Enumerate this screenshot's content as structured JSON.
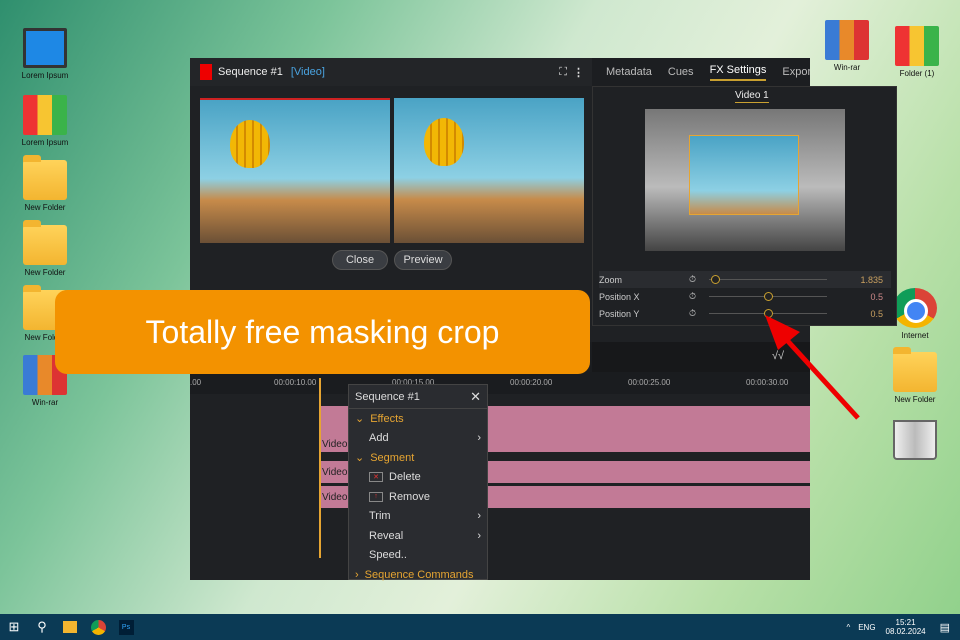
{
  "desktop": {
    "left_icons": [
      {
        "label": "Lorem Ipsum",
        "type": "monitor"
      },
      {
        "label": "Lorem Ipsum",
        "type": "binders"
      },
      {
        "label": "New Folder",
        "type": "folder"
      },
      {
        "label": "New Folder",
        "type": "folder"
      },
      {
        "label": "New Folder",
        "type": "folder"
      },
      {
        "label": "Win-rar",
        "type": "rar"
      }
    ],
    "right_icons": [
      {
        "label": "Win-rar",
        "type": "rar"
      },
      {
        "label": "Folder (1)",
        "type": "binders"
      },
      {
        "label": "Internet",
        "type": "chrome"
      },
      {
        "label": "New Folder",
        "type": "folder"
      },
      {
        "label": "",
        "type": "trash"
      }
    ]
  },
  "app": {
    "title": "Sequence #1",
    "title_tag": "[Video]",
    "tabs": [
      "Metadata",
      "Cues",
      "FX Settings",
      "Export"
    ],
    "active_tab": "FX Settings",
    "subtab": "Video 1",
    "buttons": {
      "close": "Close",
      "preview": "Preview"
    },
    "fx_params": [
      {
        "label": "Zoom",
        "value": "1.835",
        "slider": 0.05
      },
      {
        "label": "Position X",
        "value": "0.5",
        "slider": 0.5
      },
      {
        "label": "Position Y",
        "value": "0.5",
        "slider": 0.5
      }
    ],
    "ruler": [
      ".00",
      "00:00:10.00",
      "00:00:15.00",
      "00:00:20.00",
      "00:00:25.00",
      "00:00:30.00"
    ],
    "clip_label": "Video"
  },
  "menu": {
    "title": "Sequence #1",
    "items": [
      {
        "label": "Effects",
        "kind": "section"
      },
      {
        "label": "Add",
        "kind": "sub"
      },
      {
        "label": "Segment",
        "kind": "section"
      },
      {
        "label": "Delete",
        "kind": "icon"
      },
      {
        "label": "Remove",
        "kind": "icon"
      },
      {
        "label": "Trim",
        "kind": "sub"
      },
      {
        "label": "Reveal",
        "kind": "sub"
      },
      {
        "label": "Speed..",
        "kind": "item"
      },
      {
        "label": "Sequence Commands",
        "kind": "section-collapsed"
      }
    ]
  },
  "banner": {
    "text": "Totally free masking crop",
    "color": "#f39200"
  },
  "taskbar": {
    "lang": "ENG",
    "time": "15:21",
    "date": "08.02.2024"
  }
}
